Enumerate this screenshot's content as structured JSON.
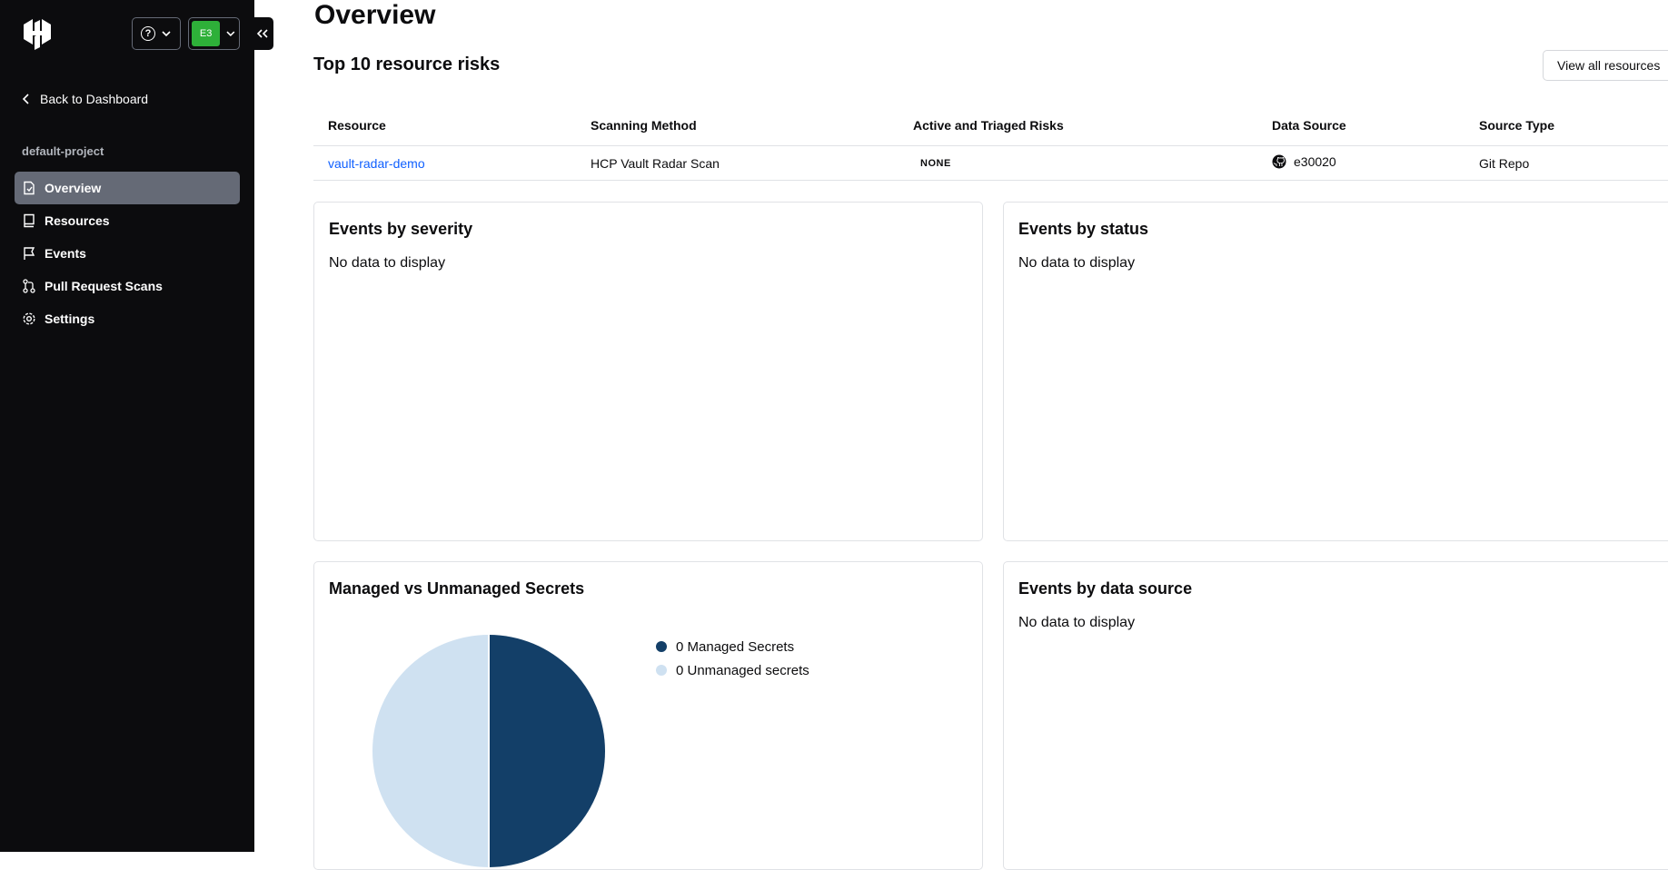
{
  "sidebar": {
    "back_label": "Back to Dashboard",
    "help_label": "?",
    "org_initials": "E3",
    "project": "default-project",
    "items": [
      {
        "label": "Overview",
        "icon": "document-icon"
      },
      {
        "label": "Resources",
        "icon": "book-icon"
      },
      {
        "label": "Events",
        "icon": "flag-icon"
      },
      {
        "label": "Pull Request Scans",
        "icon": "git-pull-request-icon"
      },
      {
        "label": "Settings",
        "icon": "gear-icon"
      }
    ]
  },
  "main": {
    "title": "Overview",
    "risks_title": "Top 10 resource risks",
    "view_all_label": "View all resources",
    "table": {
      "headers": [
        "Resource",
        "Scanning Method",
        "Active and Triaged Risks",
        "Data Source",
        "Source Type"
      ],
      "rows": [
        {
          "resource": "vault-radar-demo",
          "method": "HCP Vault Radar Scan",
          "risks": "NONE",
          "source": "e30020",
          "type": "Git Repo"
        }
      ]
    },
    "cards": {
      "severity": {
        "title": "Events by severity",
        "empty": "No data to display"
      },
      "status": {
        "title": "Events by status",
        "empty": "No data to display"
      },
      "managed": {
        "title": "Managed vs Unmanaged Secrets",
        "legend": [
          "0 Managed Secrets",
          "0 Unmanaged secrets"
        ]
      },
      "datasource": {
        "title": "Events by data source",
        "empty": "No data to display"
      }
    }
  },
  "colors": {
    "sidebar_bg": "#0c0c0e",
    "active_nav": "#656a76",
    "org_avatar": "#2eb039",
    "link": "#1060ff",
    "managed": "#133f68",
    "unmanaged": "#cfe1f1"
  },
  "chart_data": {
    "type": "pie",
    "categories": [
      "Managed Secrets",
      "Unmanaged secrets"
    ],
    "values": [
      0,
      0
    ],
    "title": "Managed vs Unmanaged Secrets",
    "legend_position": "right"
  }
}
